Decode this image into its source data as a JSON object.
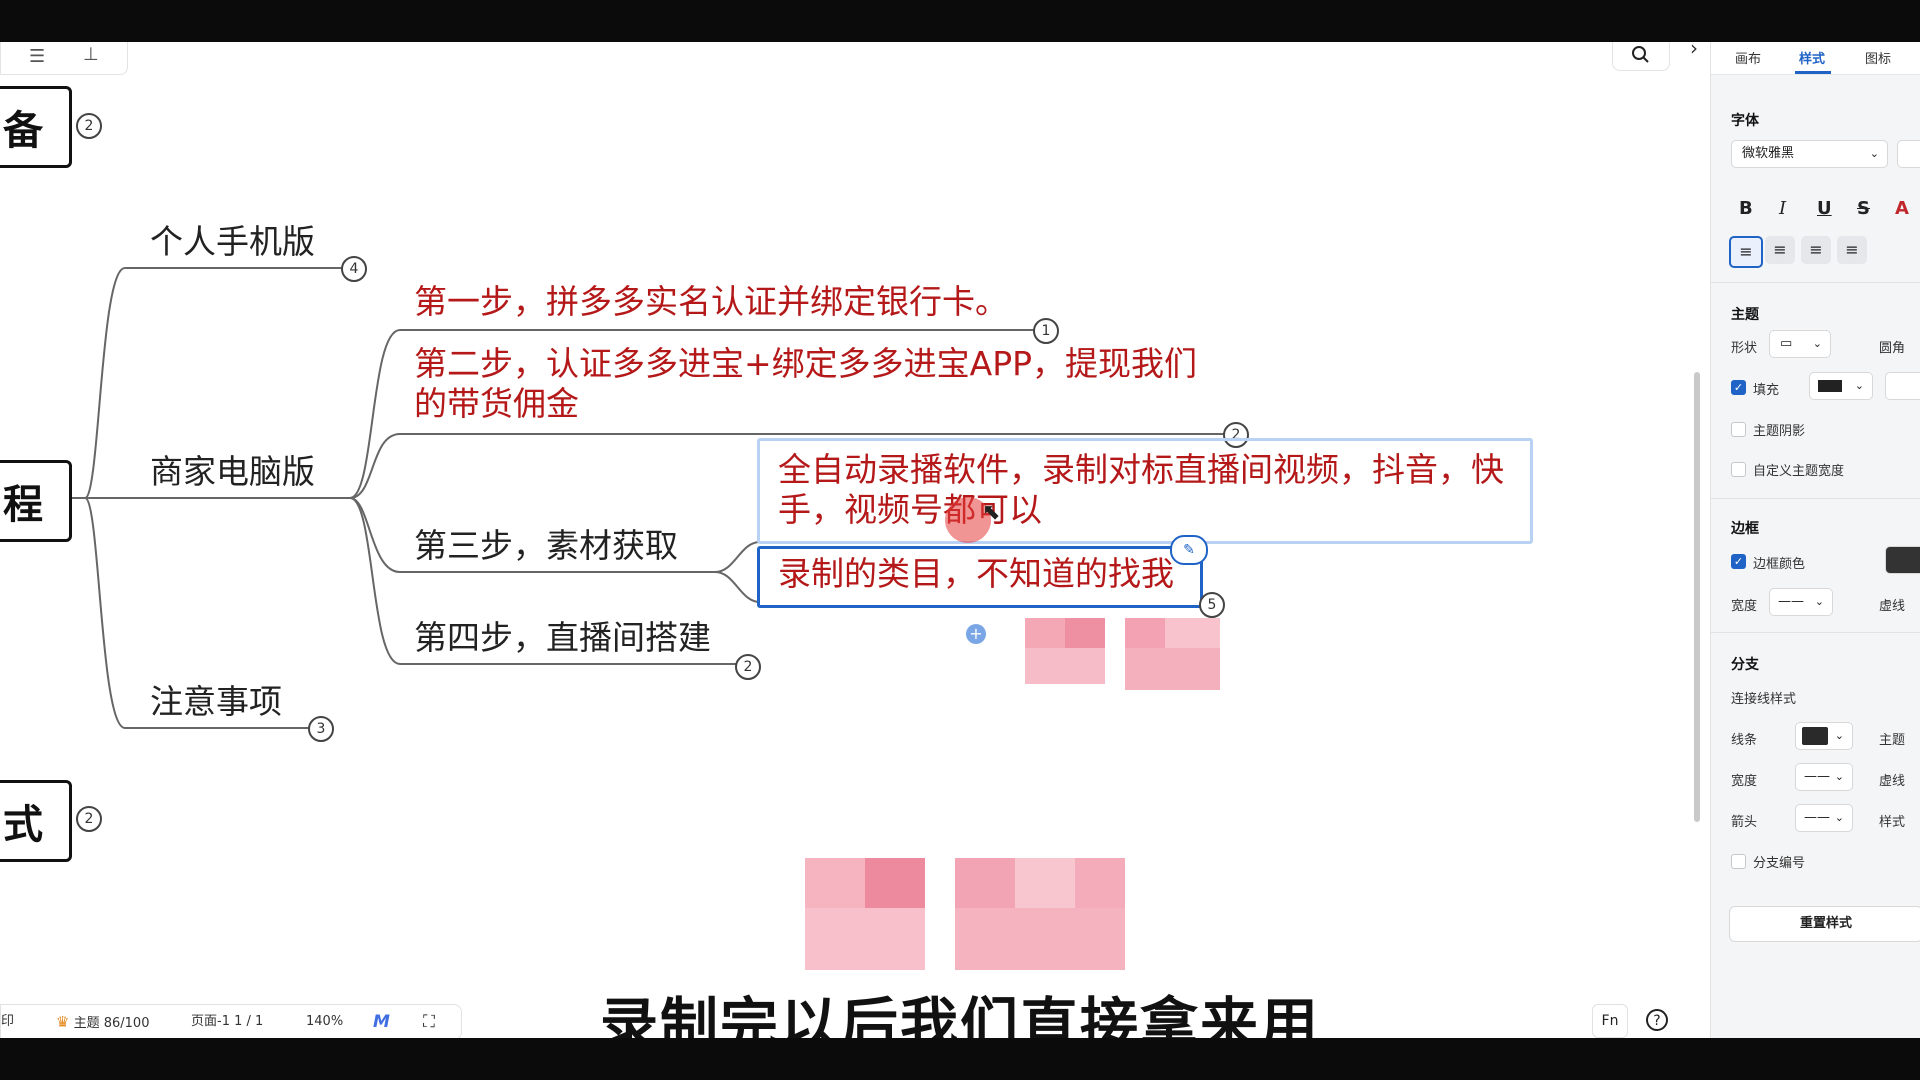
{
  "canvas": {
    "roots": [
      {
        "text": "备",
        "badge": "2"
      },
      {
        "text": "程"
      },
      {
        "text": "式",
        "badge": "2"
      }
    ],
    "branches": [
      {
        "text": "个人手机版",
        "badge": "4"
      },
      {
        "text": "商家电脑版"
      },
      {
        "text": "注意事项",
        "badge": "3"
      }
    ],
    "steps": [
      {
        "text": "第一步，拼多多实名认证并绑定银行卡。",
        "badge": "1"
      },
      {
        "line1": "第二步，认证多多进宝+绑定多多进宝APP，提现我们",
        "line2": "的带货佣金",
        "badge": "2"
      },
      {
        "text": "第三步，素材获取"
      },
      {
        "text": "第四步，直播间搭建",
        "badge": "2"
      }
    ],
    "children": [
      {
        "line1": "全自动录播软件，录制对标直播间视频，抖音，快",
        "line2": "手，视频号都可以"
      },
      {
        "text": "录制的类目，不知道的找我",
        "badge": "5"
      }
    ]
  },
  "status": {
    "topic_count": "主题 86/100",
    "page": "页面-1  1 / 1",
    "zoom": "140%",
    "left_cut": "印"
  },
  "subtitle": "录制完以后我们直接拿来用",
  "panel": {
    "tabs": [
      "画布",
      "样式",
      "图标"
    ],
    "active_tab": "样式",
    "font_section": "字体",
    "font_family": "微软雅黑",
    "format_buttons": [
      "B",
      "I",
      "U",
      "S",
      "A"
    ],
    "topic_section": "主题",
    "shape_label": "形状",
    "corner_label": "圆角",
    "fill_label": "填充",
    "shadow_label": "主题阴影",
    "custom_width_label": "自定义主题宽度",
    "border_section": "边框",
    "border_color_label": "边框颜色",
    "width_label": "宽度",
    "dash_label": "虚线",
    "branch_section": "分支",
    "connector_style_label": "连接线样式",
    "line_label": "线条",
    "theme_label": "主题",
    "branch_width_label": "宽度",
    "branch_dash_label": "虚线",
    "arrow_label": "箭头",
    "style_label": "样式",
    "branch_number_label": "分支编号",
    "reset_button": "重置样式"
  },
  "colors": {
    "accent": "#1f63c6",
    "step_text": "#b41818",
    "node_text": "#222222"
  }
}
